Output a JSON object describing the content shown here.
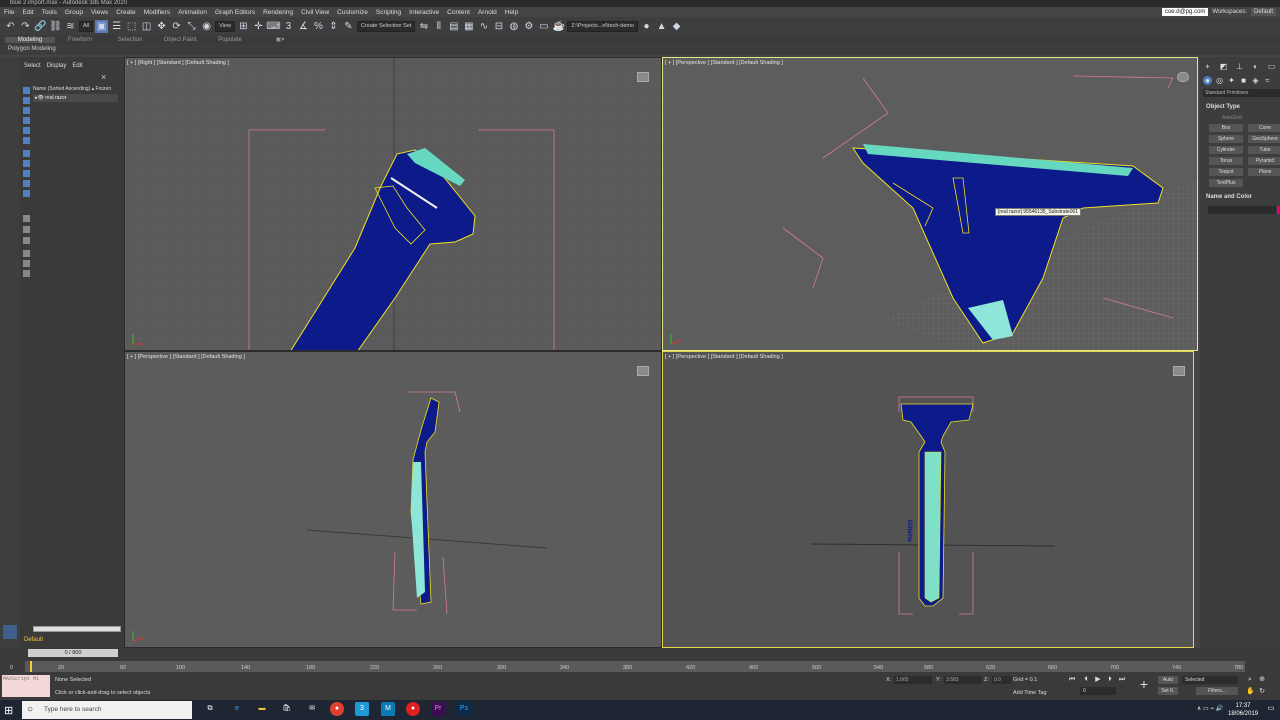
{
  "window": {
    "title": "blue 2 import.max - Autodesk 3ds Max 2020"
  },
  "menu": [
    "File",
    "Edit",
    "Tools",
    "Group",
    "Views",
    "Create",
    "Modifiers",
    "Animation",
    "Graph Editors",
    "Rendering",
    "Civil View",
    "Customize",
    "Scripting",
    "Interactive",
    "Content",
    "Arnold",
    "Help"
  ],
  "account": {
    "user": "coe.d@pg.com",
    "workspaces_label": "Workspaces:",
    "workspace": "Default"
  },
  "toolbar": {
    "filter": "All",
    "ref_coord": "View",
    "selection_set": "Create Selection Set",
    "project_path": "Z:\\Projects...el\\tech-demo"
  },
  "ribbon": {
    "tabs": [
      "Modeling",
      "Freeform",
      "Selection",
      "Object Paint",
      "Populate"
    ],
    "subpanel": "Polygon Modeling"
  },
  "scene_explorer": {
    "menus": [
      "Select",
      "Display",
      "Edit"
    ],
    "header": "Name (Sorted Ascending) ▴ Frozen",
    "objects": [
      "real razor"
    ],
    "layer": "Default"
  },
  "viewports": {
    "top_left": "[ + ] [Right ] [Standard ] [Default Shading ]",
    "top_right": "[ + ] [Perspective ] [Standard ] [Default Shading ]",
    "bottom_left": "[ + ] [Perspective ] [Standard ] [Default Shading ]",
    "bottom_right": "[ + ] [Perspective ] [Standard ] [Default Shading ]",
    "tooltip": "[real razor] 95546135_Substrate001",
    "brand_label": "Gillette"
  },
  "command_panel": {
    "dropdown": "Standard Primitives",
    "object_type_title": "Object Type",
    "autogrid": "AutoGrid",
    "buttons": [
      "Box",
      "Cone",
      "Sphere",
      "GeoSphere",
      "Cylinder",
      "Tube",
      "Torus",
      "Pyramid",
      "Teapot",
      "Plane",
      "TextPlus"
    ],
    "name_color_title": "Name and Color",
    "colors": {
      "object": "#e0007a"
    }
  },
  "timeline": {
    "slider": "0 / 800",
    "ticks": [
      "0",
      "20",
      "60",
      "100",
      "140",
      "180",
      "220",
      "260",
      "300",
      "340",
      "380",
      "420",
      "460",
      "500",
      "540",
      "580",
      "620",
      "660",
      "700",
      "740",
      "780"
    ]
  },
  "status": {
    "maxscript": "MAXScript Mi",
    "selection": "None Selected",
    "prompt": "Click or click-and-drag to select objects",
    "x_label": "X:",
    "x_value": "1.665",
    "y_label": "Y:",
    "y_value": "3.583",
    "z_label": "Z:",
    "z_value": "0.0",
    "grid": "Grid = 0.1",
    "add_time_tag": "Add Time Tag",
    "auto": "Auto",
    "selected": "Selected",
    "set_key": "Set K.",
    "filters": "Filters...",
    "frame": "0"
  },
  "taskbar": {
    "search": "Type here to search",
    "time": "17:37",
    "date": "18/06/2019"
  }
}
